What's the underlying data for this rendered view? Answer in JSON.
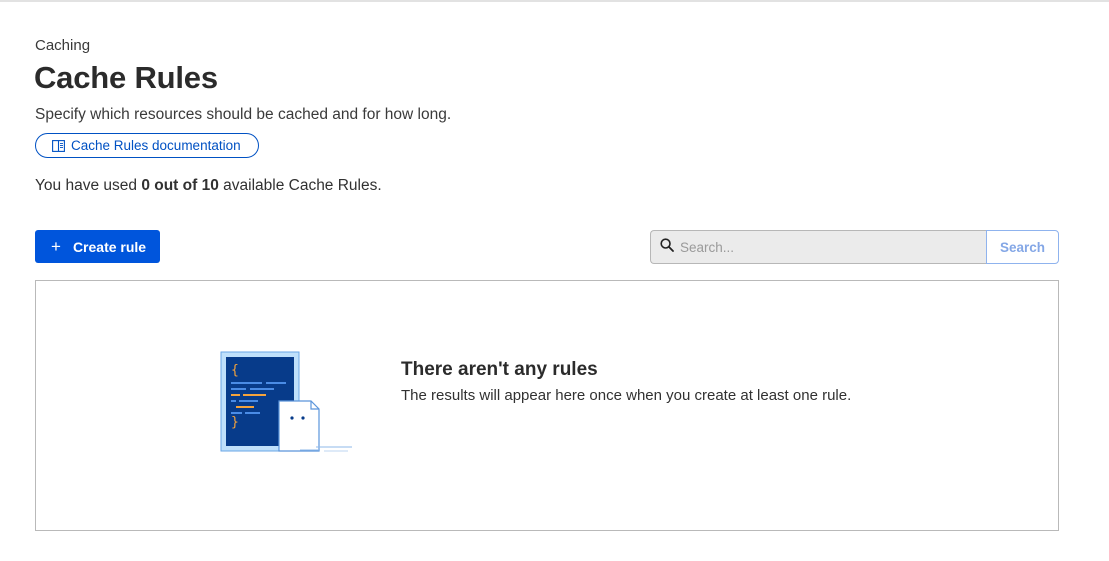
{
  "header": {
    "breadcrumb": "Caching",
    "title": "Cache Rules",
    "subtitle": "Specify which resources should be cached and for how long.",
    "doc_link_label": "Cache Rules documentation"
  },
  "usage": {
    "prefix": "You have used ",
    "count": "0 out of 10",
    "suffix": " available Cache Rules."
  },
  "toolbar": {
    "create_label": "Create rule",
    "create_icon": "plus-icon",
    "search_placeholder": "Search...",
    "search_value": "",
    "search_button_label": "Search"
  },
  "empty_state": {
    "title": "There aren't any rules",
    "description": "The results will appear here once when you create at least one rule.",
    "illustration": "code-document-icon"
  },
  "colors": {
    "primary": "#0055dc",
    "link": "#0051c3",
    "illustration_dark": "#073b8a",
    "illustration_light": "#bfe0fb"
  }
}
